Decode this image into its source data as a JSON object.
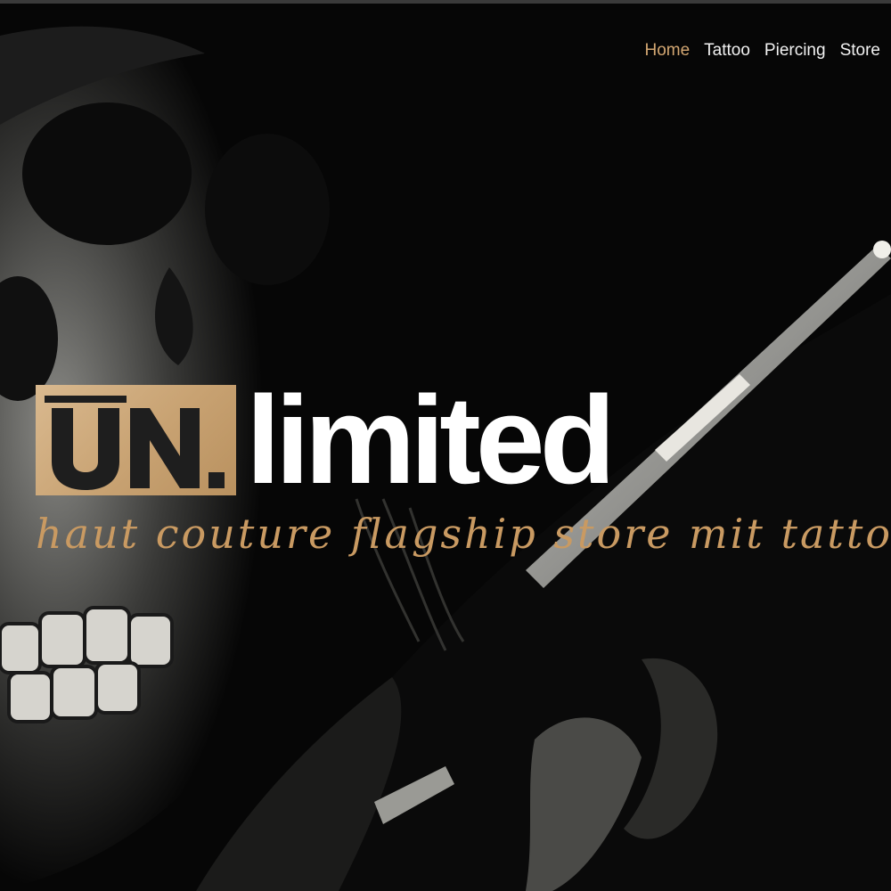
{
  "nav": {
    "items": [
      {
        "label": "Home",
        "active": true
      },
      {
        "label": "Tattoo",
        "active": false
      },
      {
        "label": "Piercing",
        "active": false
      },
      {
        "label": "Store",
        "active": false
      }
    ]
  },
  "hero": {
    "logo_box_text": "UN.",
    "logo_word": "limited",
    "tagline": "haut couture flagship store mit tattoo-und piercing"
  },
  "colors": {
    "accent": "#d3a772",
    "logo_box": "#c8a272",
    "background": "#060606",
    "text_light": "#ffffff"
  }
}
